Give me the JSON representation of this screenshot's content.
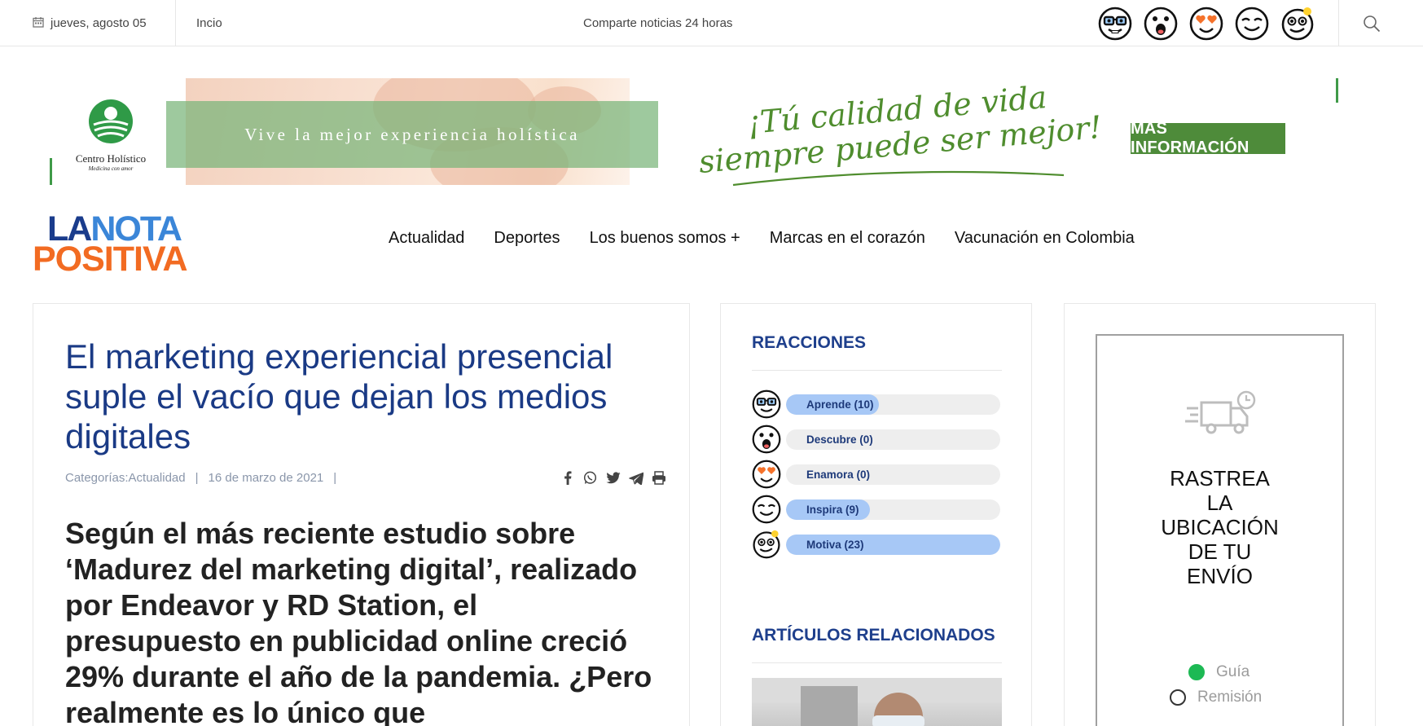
{
  "topbar": {
    "date": "jueves, agosto 05",
    "home": "Incio",
    "tagline": "Comparte noticias 24 horas",
    "icons": [
      "calendar-icon",
      "search-icon"
    ]
  },
  "banner": {
    "logo_name": "Centro Holístico",
    "logo_sub": "Medicina con amor",
    "headline": "Vive la mejor experiencia holística",
    "slogan_line1": "¡Tú calidad de vida",
    "slogan_line2": "siempre puede ser mejor!",
    "button": "MÁS INFORMACIÓN",
    "colors": {
      "green": "#4e8b3a",
      "slogan": "#4f8d2e"
    }
  },
  "site": {
    "logo_part1": "LA",
    "logo_part2": "NOTA",
    "logo_line2": "POSITIVA",
    "colors": {
      "dark_blue": "#1a3c8c",
      "light_blue": "#3b86d8",
      "orange": "#f26b22"
    }
  },
  "nav": {
    "items": [
      "Actualidad",
      "Deportes",
      "Los buenos somos +",
      "Marcas en el corazón",
      "Vacunación en Colombia"
    ]
  },
  "article": {
    "title": "El marketing experiencial presencial suple el vacío que dejan los medios digitales",
    "category": "Categorías:Actualidad",
    "separator": "|",
    "date": "16 de marzo de 2021",
    "share_icons": [
      "facebook-icon",
      "whatsapp-icon",
      "twitter-icon",
      "telegram-icon",
      "print-icon"
    ],
    "lead": "Según el más reciente estudio sobre ‘Madurez del marketing digital’, realizado por Endeavor y RD Station, el presupuesto en publicidad online creció 29% durante el año de la pandemia. ¿Pero realmente es lo único que"
  },
  "reactions": {
    "heading": "REACCIONES",
    "items": [
      {
        "label": "Aprende (10)",
        "count": 10,
        "icon": "nerd-glasses-emoji"
      },
      {
        "label": "Descubre (0)",
        "count": 0,
        "icon": "surprised-emoji"
      },
      {
        "label": "Enamora (0)",
        "count": 0,
        "icon": "heart-eyes-emoji"
      },
      {
        "label": "Inspira (9)",
        "count": 9,
        "icon": "content-smile-emoji"
      },
      {
        "label": "Motiva (23)",
        "count": 23,
        "icon": "idea-bulb-emoji"
      }
    ],
    "bar_color": "#a7c8f6",
    "related_heading": "ARTÍCULOS RELACIONADOS"
  },
  "tracking": {
    "title_lines": [
      "RASTREA",
      "LA",
      "UBICACIÓN",
      "DE TU",
      "ENVÍO"
    ],
    "options": [
      {
        "label": "Guía",
        "selected": true
      },
      {
        "label": "Remisión",
        "selected": false
      }
    ],
    "icon": "delivery-truck-clock-icon"
  }
}
